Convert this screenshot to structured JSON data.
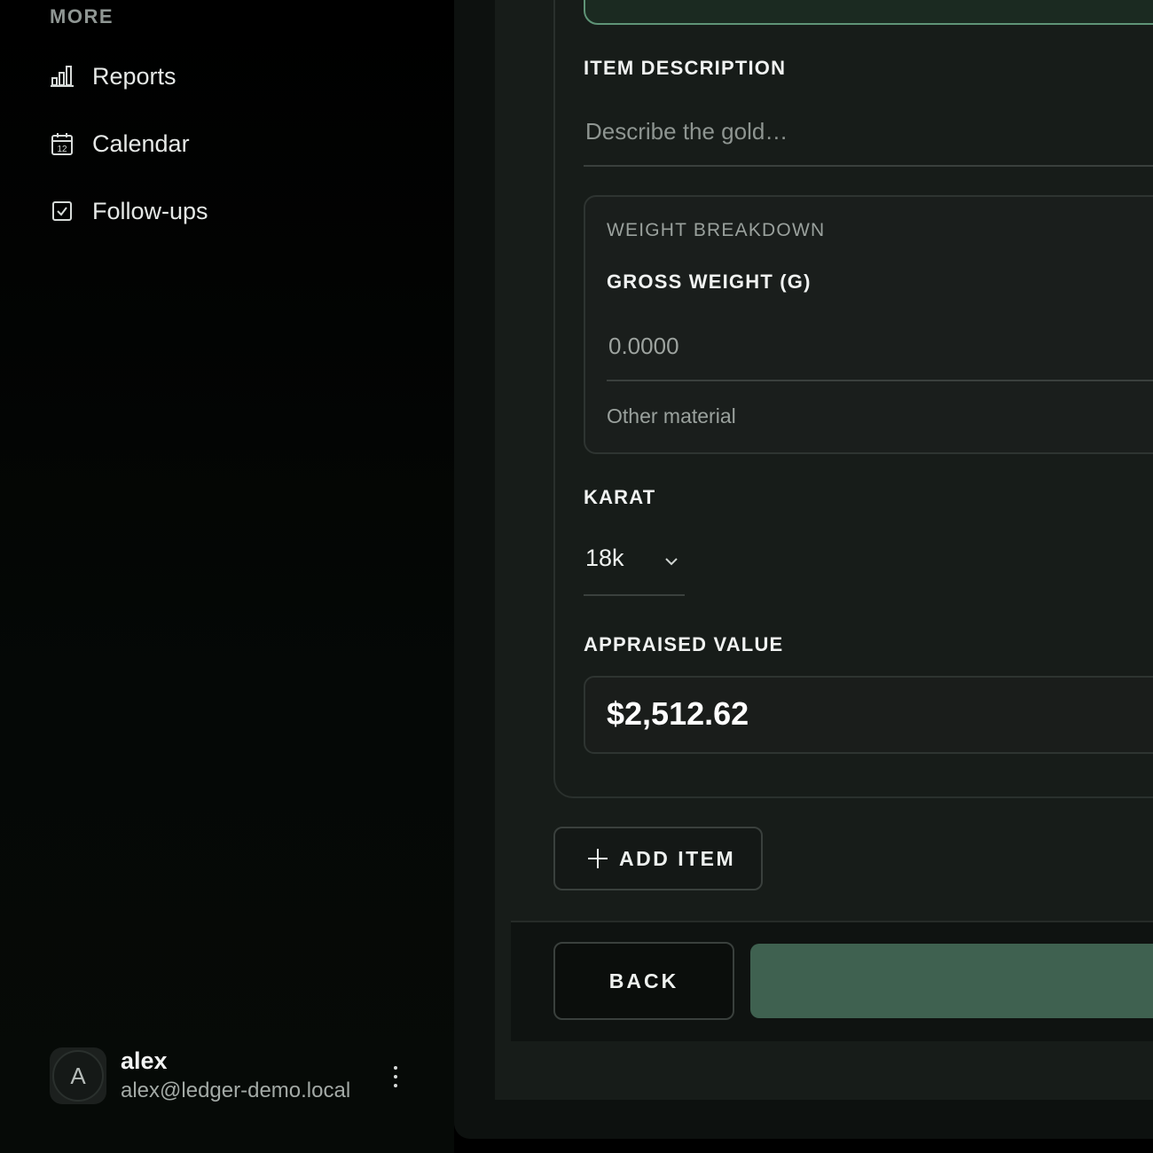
{
  "sidebar": {
    "section_label": "MORE",
    "items": [
      {
        "label": "Reports",
        "icon": "bar-chart-icon"
      },
      {
        "label": "Calendar",
        "icon": "calendar-icon",
        "icon_text": "12"
      },
      {
        "label": "Follow-ups",
        "icon": "checkbox-icon"
      }
    ],
    "user": {
      "initial": "A",
      "name": "alex",
      "email": "alex@ledger-demo.local"
    }
  },
  "form": {
    "item_description": {
      "label": "ITEM DESCRIPTION",
      "placeholder": "Describe the gold…"
    },
    "weight_breakdown": {
      "title": "WEIGHT BREAKDOWN",
      "gross_weight_label": "GROSS WEIGHT (G)",
      "gross_weight_placeholder": "0.0000",
      "other_material": "Other material"
    },
    "karat": {
      "label": "KARAT",
      "value": "18k"
    },
    "appraised": {
      "label": "APPRAISED VALUE",
      "value": "$2,512.62"
    },
    "add_item_label": "ADD ITEM"
  },
  "footer": {
    "back_label": "BACK"
  },
  "colors": {
    "accent": "#3f6150",
    "accent_border": "#5f9477",
    "background": "#000000",
    "panel": "#171c19"
  }
}
